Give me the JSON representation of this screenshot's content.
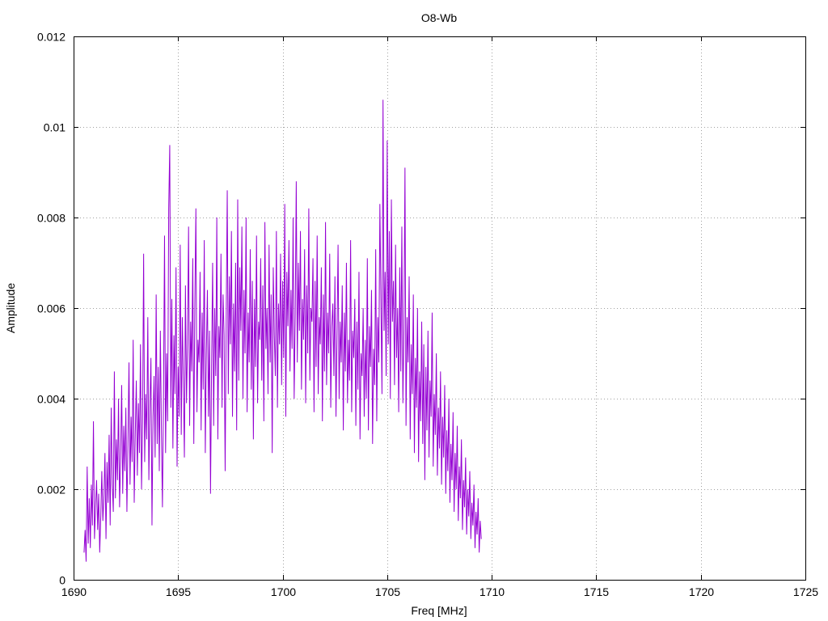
{
  "chart_data": {
    "type": "line",
    "title": "O8-Wb",
    "xlabel": "Freq [MHz]",
    "ylabel": "Amplitude",
    "xlim": [
      1690,
      1725
    ],
    "ylim": [
      0,
      0.012
    ],
    "xticks": [
      "1690",
      "1695",
      "1700",
      "1705",
      "1710",
      "1715",
      "1720",
      "1725"
    ],
    "yticks": [
      "0",
      "0.002",
      "0.004",
      "0.006",
      "0.008",
      "0.01",
      "0.012"
    ],
    "grid": true,
    "series": [
      {
        "color": "#9400d3",
        "x_start": 1690.5,
        "x_step": 0.05,
        "values": [
          0.0006,
          0.0011,
          0.0004,
          0.0025,
          0.0008,
          0.0018,
          0.0007,
          0.0021,
          0.0012,
          0.0035,
          0.0009,
          0.0016,
          0.0022,
          0.0011,
          0.0019,
          0.0006,
          0.0014,
          0.0024,
          0.0013,
          0.0018,
          0.0028,
          0.0009,
          0.0026,
          0.0017,
          0.0032,
          0.0012,
          0.0038,
          0.0021,
          0.0015,
          0.0046,
          0.0018,
          0.0031,
          0.0022,
          0.004,
          0.0016,
          0.0027,
          0.0043,
          0.0019,
          0.0034,
          0.0024,
          0.0038,
          0.0015,
          0.003,
          0.0048,
          0.0021,
          0.0036,
          0.0026,
          0.0053,
          0.0017,
          0.0032,
          0.0044,
          0.0023,
          0.0039,
          0.0028,
          0.0052,
          0.002,
          0.0035,
          0.0072,
          0.0026,
          0.0041,
          0.0031,
          0.0058,
          0.0022,
          0.0038,
          0.0049,
          0.0012,
          0.0036,
          0.0045,
          0.0027,
          0.0063,
          0.003,
          0.0047,
          0.0024,
          0.0055,
          0.0033,
          0.0016,
          0.004,
          0.0076,
          0.0028,
          0.005,
          0.0035,
          0.0082,
          0.0096,
          0.0038,
          0.0062,
          0.0029,
          0.0054,
          0.0041,
          0.0069,
          0.0025,
          0.0047,
          0.0036,
          0.0074,
          0.0032,
          0.0058,
          0.0044,
          0.0027,
          0.0065,
          0.0039,
          0.0052,
          0.0078,
          0.0034,
          0.0057,
          0.0046,
          0.0071,
          0.003,
          0.0061,
          0.0082,
          0.0037,
          0.0053,
          0.0048,
          0.0068,
          0.0033,
          0.0059,
          0.0042,
          0.0075,
          0.0028,
          0.005,
          0.0064,
          0.0036,
          0.0055,
          0.0019,
          0.0047,
          0.007,
          0.0034,
          0.006,
          0.0045,
          0.008,
          0.0031,
          0.0056,
          0.0049,
          0.0072,
          0.0038,
          0.0063,
          0.0054,
          0.0024,
          0.0058,
          0.0086,
          0.0041,
          0.0067,
          0.0052,
          0.0077,
          0.0036,
          0.0061,
          0.0046,
          0.007,
          0.0033,
          0.0084,
          0.0044,
          0.0069,
          0.0055,
          0.0078,
          0.004,
          0.0064,
          0.005,
          0.008,
          0.0037,
          0.0059,
          0.0048,
          0.0073,
          0.0042,
          0.0066,
          0.0031,
          0.0062,
          0.0047,
          0.0076,
          0.0039,
          0.0057,
          0.0053,
          0.0071,
          0.0044,
          0.0065,
          0.0035,
          0.0079,
          0.0051,
          0.006,
          0.0041,
          0.0074,
          0.0048,
          0.0063,
          0.0028,
          0.0069,
          0.0054,
          0.0045,
          0.0077,
          0.0038,
          0.0061,
          0.0052,
          0.0072,
          0.0043,
          0.0066,
          0.0049,
          0.0083,
          0.0036,
          0.0068,
          0.0056,
          0.0075,
          0.0046,
          0.0064,
          0.0051,
          0.008,
          0.004,
          0.0058,
          0.0088,
          0.0048,
          0.007,
          0.0055,
          0.0077,
          0.0042,
          0.0062,
          0.0053,
          0.0073,
          0.0039,
          0.0065,
          0.005,
          0.0082,
          0.0044,
          0.006,
          0.0057,
          0.0071,
          0.0037,
          0.0066,
          0.0047,
          0.0076,
          0.0041,
          0.0058,
          0.0052,
          0.0069,
          0.0035,
          0.0063,
          0.0046,
          0.0079,
          0.0043,
          0.0059,
          0.005,
          0.0072,
          0.0038,
          0.0056,
          0.0061,
          0.0045,
          0.0067,
          0.0036,
          0.0054,
          0.0074,
          0.004,
          0.0057,
          0.0048,
          0.0065,
          0.0033,
          0.0059,
          0.0046,
          0.007,
          0.0039,
          0.0053,
          0.0044,
          0.0075,
          0.0037,
          0.0055,
          0.0049,
          0.0062,
          0.0034,
          0.0057,
          0.0042,
          0.0068,
          0.0031,
          0.005,
          0.0045,
          0.006,
          0.0036,
          0.0053,
          0.004,
          0.0071,
          0.0033,
          0.0056,
          0.0047,
          0.0064,
          0.003,
          0.0051,
          0.0043,
          0.0073,
          0.0035,
          0.0058,
          0.0048,
          0.0083,
          0.0062,
          0.0041,
          0.0106,
          0.0055,
          0.0068,
          0.0045,
          0.0097,
          0.0052,
          0.0077,
          0.004,
          0.0084,
          0.0057,
          0.0066,
          0.0043,
          0.0074,
          0.0049,
          0.006,
          0.0037,
          0.0069,
          0.0046,
          0.0078,
          0.0039,
          0.0055,
          0.0091,
          0.0034,
          0.0058,
          0.0048,
          0.0067,
          0.0031,
          0.0052,
          0.0041,
          0.0063,
          0.0028,
          0.0049,
          0.0038,
          0.006,
          0.0026,
          0.0046,
          0.0035,
          0.0057,
          0.003,
          0.0052,
          0.0022,
          0.0047,
          0.0033,
          0.0055,
          0.0027,
          0.0044,
          0.0036,
          0.0059,
          0.0025,
          0.0041,
          0.0032,
          0.005,
          0.0023,
          0.0038,
          0.0029,
          0.0046,
          0.0021,
          0.0036,
          0.0027,
          0.0043,
          0.0019,
          0.0033,
          0.0024,
          0.004,
          0.0017,
          0.003,
          0.0022,
          0.0037,
          0.0015,
          0.0028,
          0.002,
          0.0034,
          0.0013,
          0.0025,
          0.0018,
          0.0031,
          0.0011,
          0.0022,
          0.0016,
          0.0027,
          0.001,
          0.002,
          0.0014,
          0.0024,
          0.0009,
          0.0017,
          0.0012,
          0.0021,
          0.0007,
          0.0015,
          0.001,
          0.0018,
          0.0006,
          0.0013,
          0.0009
        ]
      }
    ]
  }
}
